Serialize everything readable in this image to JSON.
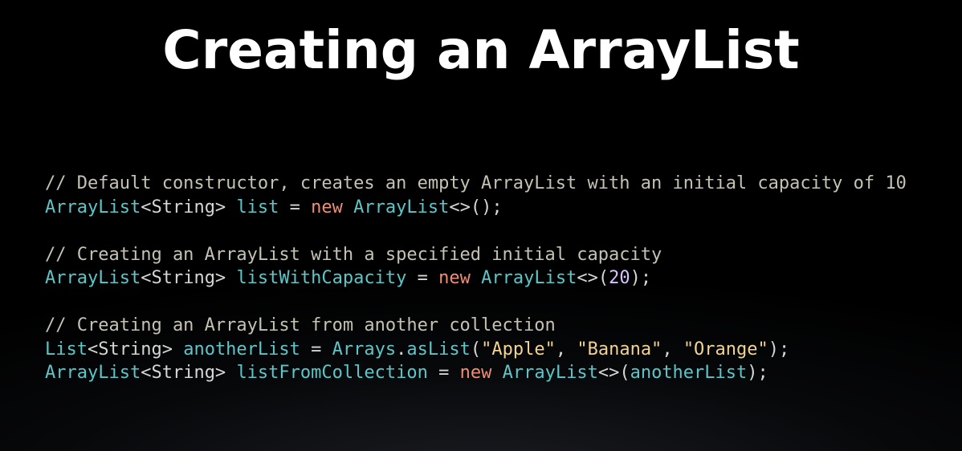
{
  "slide": {
    "title": "Creating an ArrayList"
  },
  "code": {
    "lines": [
      [
        {
          "text": "// Default constructor, creates an empty ArrayList with an initial capacity of 10",
          "kind": "comment"
        }
      ],
      [
        {
          "text": "ArrayList",
          "kind": "type"
        },
        {
          "text": "<String> ",
          "kind": "punct"
        },
        {
          "text": "list",
          "kind": "ident"
        },
        {
          "text": " = ",
          "kind": "punct"
        },
        {
          "text": "new",
          "kind": "kw"
        },
        {
          "text": " ",
          "kind": "punct"
        },
        {
          "text": "ArrayList",
          "kind": "type"
        },
        {
          "text": "<>();",
          "kind": "punct"
        }
      ],
      [],
      [
        {
          "text": "// Creating an ArrayList with a specified initial capacity",
          "kind": "comment"
        }
      ],
      [
        {
          "text": "ArrayList",
          "kind": "type"
        },
        {
          "text": "<String> ",
          "kind": "punct"
        },
        {
          "text": "listWithCapacity",
          "kind": "ident"
        },
        {
          "text": " = ",
          "kind": "punct"
        },
        {
          "text": "new",
          "kind": "kw"
        },
        {
          "text": " ",
          "kind": "punct"
        },
        {
          "text": "ArrayList",
          "kind": "type"
        },
        {
          "text": "<>(",
          "kind": "punct"
        },
        {
          "text": "20",
          "kind": "num"
        },
        {
          "text": ");",
          "kind": "punct"
        }
      ],
      [],
      [
        {
          "text": "// Creating an ArrayList from another collection",
          "kind": "comment"
        }
      ],
      [
        {
          "text": "List",
          "kind": "type"
        },
        {
          "text": "<String> ",
          "kind": "punct"
        },
        {
          "text": "anotherList",
          "kind": "ident"
        },
        {
          "text": " = ",
          "kind": "punct"
        },
        {
          "text": "Arrays",
          "kind": "type"
        },
        {
          "text": ".",
          "kind": "punct"
        },
        {
          "text": "asList",
          "kind": "ident"
        },
        {
          "text": "(",
          "kind": "punct"
        },
        {
          "text": "\"Apple\"",
          "kind": "str"
        },
        {
          "text": ", ",
          "kind": "punct"
        },
        {
          "text": "\"Banana\"",
          "kind": "str"
        },
        {
          "text": ", ",
          "kind": "punct"
        },
        {
          "text": "\"Orange\"",
          "kind": "str"
        },
        {
          "text": ");",
          "kind": "punct"
        }
      ],
      [
        {
          "text": "ArrayList",
          "kind": "type"
        },
        {
          "text": "<String> ",
          "kind": "punct"
        },
        {
          "text": "listFromCollection",
          "kind": "ident"
        },
        {
          "text": " = ",
          "kind": "punct"
        },
        {
          "text": "new",
          "kind": "kw"
        },
        {
          "text": " ",
          "kind": "punct"
        },
        {
          "text": "ArrayList",
          "kind": "type"
        },
        {
          "text": "<>(",
          "kind": "punct"
        },
        {
          "text": "anotherList",
          "kind": "ident"
        },
        {
          "text": ");",
          "kind": "punct"
        }
      ]
    ]
  },
  "colors": {
    "background": "#000000",
    "title": "#ffffff",
    "comment": "#c5c2b4",
    "type": "#5cc6c9",
    "keyword": "#f08d76",
    "string": "#f3d38f",
    "number": "#d8c2ff",
    "punctuation": "#d6d6d6"
  }
}
